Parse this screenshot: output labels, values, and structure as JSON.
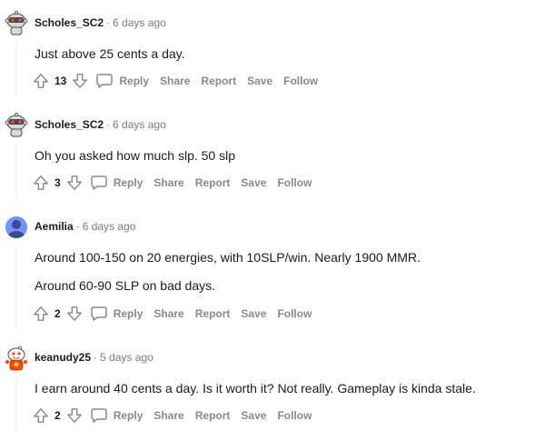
{
  "comments": [
    {
      "author": "Scholes_SC2",
      "time": "6 days ago",
      "paragraphs": [
        "Just above 25 cents a day."
      ],
      "score": "13",
      "avatar": "snoo-robot-avatar"
    },
    {
      "author": "Scholes_SC2",
      "time": "6 days ago",
      "paragraphs": [
        "Oh you asked how much slp. 50 slp"
      ],
      "score": "3",
      "avatar": "snoo-robot-avatar"
    },
    {
      "author": "Aemilia",
      "time": "6 days ago",
      "paragraphs": [
        "Around 100-150 on 20 energies, with 10SLP/win. Nearly 1900 MMR.",
        "Around 60-90 SLP on bad days."
      ],
      "score": "2",
      "avatar": "default-user-avatar"
    },
    {
      "author": "keanudy25",
      "time": "5 days ago",
      "paragraphs": [
        "I earn around 40 cents a day. Is it worth it? Not really. Gameplay is kinda stale."
      ],
      "score": "2",
      "avatar": "snoo-red-avatar"
    }
  ],
  "actions": {
    "reply": "Reply",
    "share": "Share",
    "report": "Report",
    "save": "Save",
    "follow": "Follow"
  },
  "separator": "·",
  "colors": {
    "meta_gray": "#7c7c7c",
    "action_gray": "#878a8c",
    "text": "#1c1c1c",
    "avatar_blue": "#7193ff",
    "snoo_red": "#ff4500"
  }
}
